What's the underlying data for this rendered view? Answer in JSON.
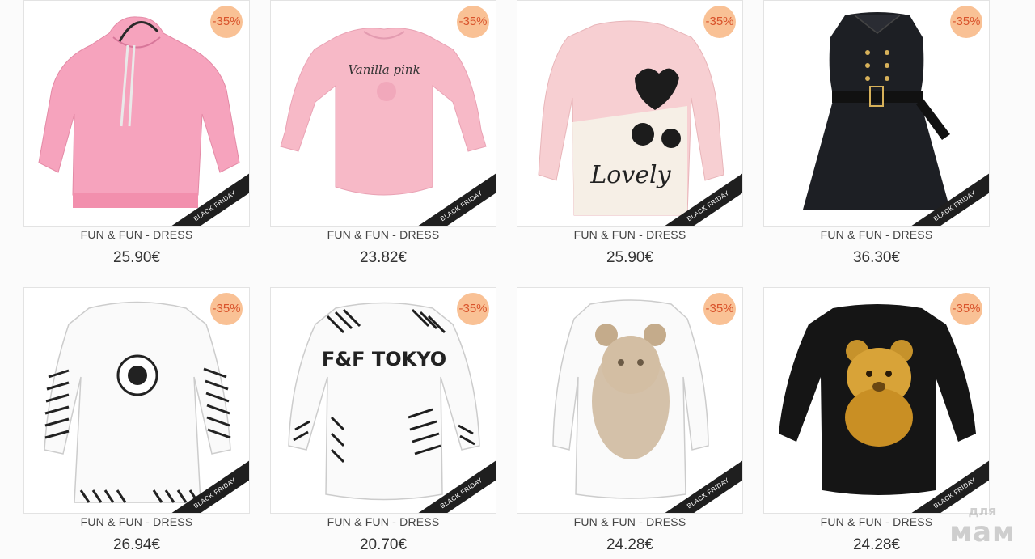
{
  "products": [
    {
      "title": "FUN & FUN - DRESS",
      "price": "25.90€",
      "discount": "-35%",
      "ribbon": "BLACK FRIDAY",
      "icon": "pink-hoodie-dress-icon",
      "print_text": ""
    },
    {
      "title": "FUN & FUN - DRESS",
      "price": "23.82€",
      "discount": "-35%",
      "ribbon": "BLACK FRIDAY",
      "icon": "pink-sweatshirt-icon",
      "print_text": "Vanilla pink"
    },
    {
      "title": "FUN & FUN - DRESS",
      "price": "25.90€",
      "discount": "-35%",
      "ribbon": "BLACK FRIDAY",
      "icon": "pink-knit-sweater-dress-icon",
      "print_text": "Lovely"
    },
    {
      "title": "FUN & FUN - DRESS",
      "price": "36.30€",
      "discount": "-35%",
      "ribbon": "BLACK FRIDAY",
      "icon": "black-sleeveless-dress-icon",
      "print_text": ""
    },
    {
      "title": "FUN & FUN - DRESS",
      "price": "26.94€",
      "discount": "-35%",
      "ribbon": "BLACK FRIDAY",
      "icon": "white-striped-dress-icon",
      "print_text": ""
    },
    {
      "title": "FUN & FUN - DRESS",
      "price": "20.70€",
      "discount": "-35%",
      "ribbon": "BLACK FRIDAY",
      "icon": "white-ff-sweatshirt-icon",
      "print_text": "F&F TOKYO"
    },
    {
      "title": "FUN & FUN - DRESS",
      "price": "24.28€",
      "discount": "-35%",
      "ribbon": "BLACK FRIDAY",
      "icon": "white-bear-sweatshirt-icon",
      "print_text": ""
    },
    {
      "title": "FUN & FUN - DRESS",
      "price": "24.28€",
      "discount": "-35%",
      "ribbon": "BLACK FRIDAY",
      "icon": "black-bear-sweatshirt-icon",
      "print_text": ""
    }
  ],
  "watermark": {
    "line1": "для",
    "line2": "мам"
  },
  "colors": {
    "badge_bg": "#f9c195",
    "badge_text": "#d9532b",
    "ribbon_bg": "#1f1f1f",
    "border": "#e3e3e3"
  }
}
